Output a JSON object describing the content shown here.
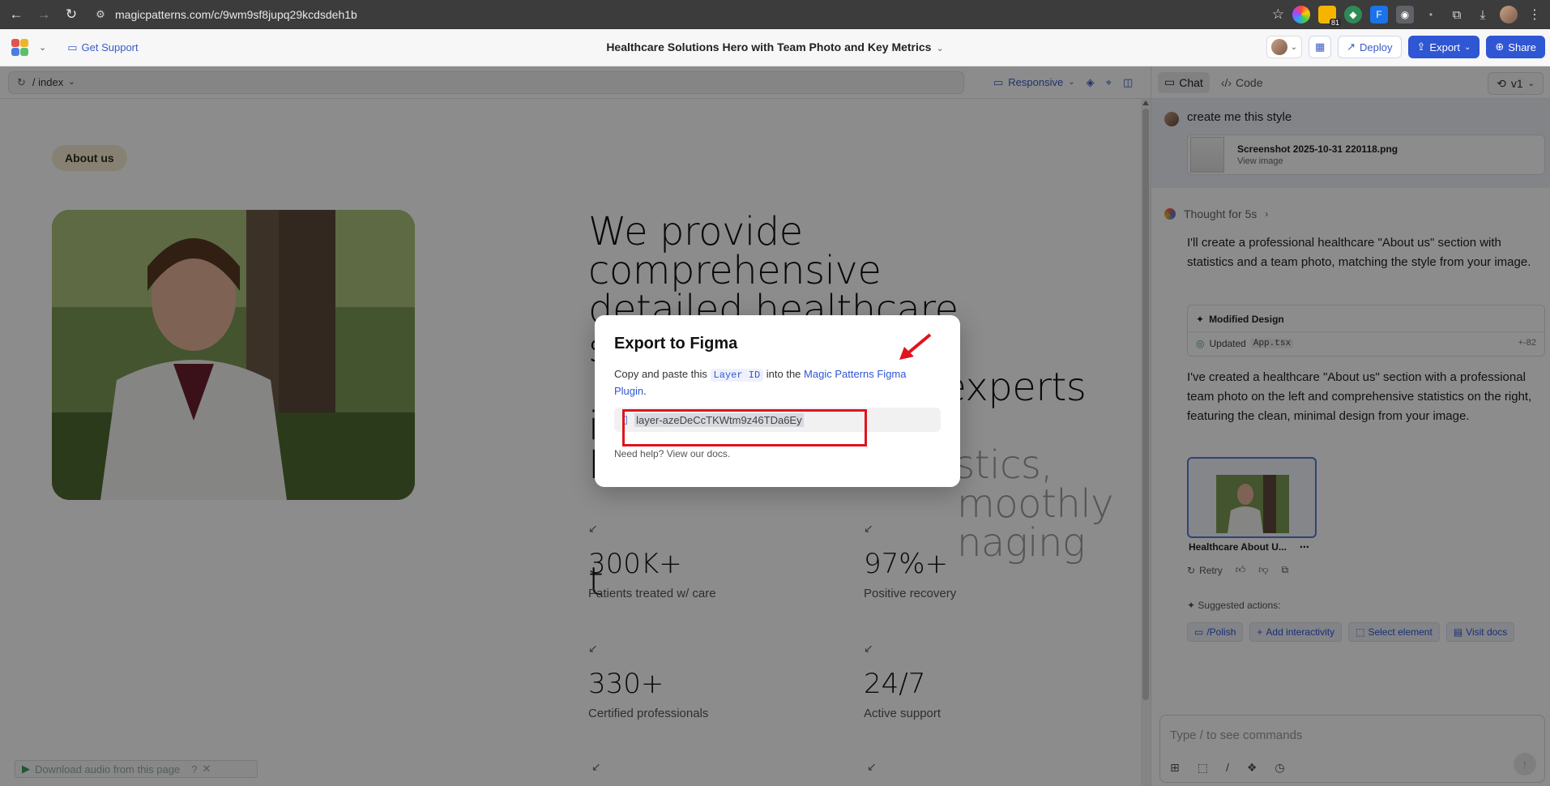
{
  "browser": {
    "url": "magicpatterns.com/c/9wm9sf8jupq29kcdsdeh1b",
    "ext_badge": "81"
  },
  "header": {
    "support_label": "Get Support",
    "project_title": "Healthcare Solutions Hero with Team Photo and Key Metrics",
    "deploy_label": "Deploy",
    "export_label": "Export",
    "share_label": "Share"
  },
  "toolbar": {
    "route": "/ index",
    "responsive_label": "Responsive"
  },
  "preview": {
    "badge": "About us",
    "headline_line1": "We provide comprehensive",
    "headline_line2": "detailed healthcare solutions",
    "headline_line3_tail": "from experts in",
    "headline_line4": "N",
    "headline_line4_tail": "ostics,",
    "headline_line5_tail": "moothly",
    "headline_line6_tail": "naging",
    "headline_line7": "t",
    "stats": [
      {
        "value": "300K+",
        "label": "Patients treated w/ care"
      },
      {
        "value": "97%+",
        "label": "Positive recovery"
      },
      {
        "value": "330+",
        "label": "Certified professionals"
      },
      {
        "value": "24/7",
        "label": "Active support"
      }
    ],
    "audio_ext": "Download audio from this page"
  },
  "modal": {
    "title": "Export to Figma",
    "desc_prefix": "Copy and paste this",
    "desc_code": "Layer ID",
    "desc_mid": "into the",
    "desc_link": "Magic Patterns Figma Plugin",
    "desc_suffix": ".",
    "layer_id": "layer-azeDeCcTKWtm9z46TDa6Ey",
    "help": "Need help? View our docs."
  },
  "chat": {
    "tab_chat": "Chat",
    "tab_code": "Code",
    "version": "v1",
    "user_message": "create me this style",
    "attachment_name": "Screenshot 2025-10-31 220118.png",
    "attachment_action": "View image",
    "thought": "Thought for 5s",
    "ai_para1": "I'll create a professional healthcare \"About us\" section with statistics and a team photo, matching the style from your image.",
    "modified_title": "Modified Design",
    "updated_label": "Updated",
    "updated_file": "App.tsx",
    "diff": "+-82",
    "ai_para2": "I've created a healthcare \"About us\" section with a professional team photo on the left and comprehensive statistics on the right, featuring the clean, minimal design from your image.",
    "preview_label": "Healthcare About U...",
    "retry": "Retry",
    "suggested_title": "Suggested actions:",
    "chips": [
      "/Polish",
      "Add interactivity",
      "Select element",
      "Visit docs"
    ],
    "input_placeholder": "Type / to see commands"
  },
  "colors": {
    "accent": "#2f56d3",
    "highlight_red": "#e0141c",
    "about_pill_bg": "#f5ecd0"
  }
}
